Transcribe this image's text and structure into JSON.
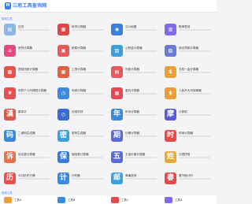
{
  "header": {
    "logo_glyph": "M",
    "site_name": "三思工具查询网"
  },
  "sections": {
    "first": "常用工具",
    "second": "查询工具"
  },
  "tools": [
    {
      "label": "日历",
      "icon": "calendar-icon",
      "glyph": "▤",
      "color": "#8bb8e8"
    },
    {
      "label": "科学计算器",
      "icon": "calculator-icon",
      "glyph": "▦",
      "color": "#e04848"
    },
    {
      "label": "汉斗地图",
      "icon": "map-icon",
      "glyph": "◉",
      "color": "#3a7fe0"
    },
    {
      "label": "账单签到",
      "icon": "bill-icon",
      "glyph": "▥",
      "color": "#7f6ae8"
    },
    {
      "label": "房贷计算器",
      "icon": "house-loan-icon",
      "glyph": "⌂",
      "color": "#e84a7f"
    },
    {
      "label": "税费计算器",
      "icon": "tax-icon",
      "glyph": "▣",
      "color": "#e85a5a"
    },
    {
      "label": "公积金计算器",
      "icon": "fund-icon",
      "glyph": "▧",
      "color": "#3aa0e0"
    },
    {
      "label": "综合贷款计算器",
      "icon": "loan-icon",
      "glyph": "▨",
      "color": "#6a7ad8"
    },
    {
      "label": "提前还款计算器",
      "icon": "repay-icon",
      "glyph": "▩",
      "color": "#e8504a"
    },
    {
      "label": "工资计算器",
      "icon": "salary-icon",
      "glyph": "▦",
      "color": "#e06040"
    },
    {
      "label": "利息计算器",
      "icon": "interest-icon",
      "glyph": "▤",
      "color": "#e8585f"
    },
    {
      "label": "五险一金计算器",
      "icon": "insurance-icon",
      "glyph": "$",
      "color": "#e8a03a"
    },
    {
      "label": "年终个人所得税计算器",
      "icon": "tax-person-icon",
      "glyph": "¥",
      "color": "#e85050"
    },
    {
      "label": "年龄计算器",
      "icon": "age-icon",
      "glyph": "◷",
      "color": "#3a8ae0"
    },
    {
      "label": "复利计算器",
      "icon": "compound-icon",
      "glyph": "▦",
      "color": "#e8484f"
    },
    {
      "label": "人民币大写转换器",
      "icon": "rmb-icon",
      "glyph": "$",
      "color": "#e8a03a"
    },
    {
      "label": "繁体字",
      "icon": "traditional-icon",
      "glyph": "漢",
      "color": "#e05848"
    },
    {
      "label": "在线时钟",
      "icon": "clock-icon",
      "glyph": "◴",
      "color": "#3a6ad8"
    },
    {
      "label": "年份计算器",
      "icon": "year-icon",
      "glyph": "年",
      "color": "#3a8ae0"
    },
    {
      "label": "计算机",
      "icon": "computer-icon",
      "glyph": "摩",
      "color": "#5a5ad8"
    },
    {
      "label": "二维码生成器",
      "icon": "qrcode-icon",
      "glyph": "码",
      "color": "#3a8ae0"
    },
    {
      "label": "密码生成器",
      "icon": "password-icon",
      "glyph": "密",
      "color": "#3aa0e0"
    },
    {
      "label": "日期计算器",
      "icon": "date-icon",
      "glyph": "期",
      "color": "#5a6ad8"
    },
    {
      "label": "时间计算器",
      "icon": "time-icon",
      "glyph": "时",
      "color": "#e84a4a"
    },
    {
      "label": "诉讼费计算器",
      "icon": "lawsuit-icon",
      "glyph": "诉",
      "color": "#e8704a"
    },
    {
      "label": "保险费计算器",
      "icon": "premium-icon",
      "glyph": "保",
      "color": "#3a7ad8"
    },
    {
      "label": "五金价格计算器",
      "icon": "hardware-icon",
      "glyph": "五",
      "color": "#5a6ad8"
    },
    {
      "label": "汉语拼音",
      "icon": "pinyin-icon",
      "glyph": "姓",
      "color": "#e8a83a"
    },
    {
      "label": "今日历史行情",
      "icon": "history-icon",
      "glyph": "历",
      "color": "#e8504a"
    },
    {
      "label": "计时器",
      "icon": "timer-icon",
      "glyph": "计",
      "color": "#3a8ae0"
    },
    {
      "label": "邮编查询",
      "icon": "postcode-icon",
      "glyph": "邮",
      "color": "#3aa0e0"
    },
    {
      "label": "春节倒计时",
      "icon": "spring-icon",
      "glyph": "春",
      "color": "#e84848"
    }
  ],
  "bottom_tools": [
    {
      "label": "工具A",
      "color": "#e8a03a"
    },
    {
      "label": "工具B",
      "color": "#3a8ae0"
    },
    {
      "label": "工具C",
      "color": "#e84a4a"
    },
    {
      "label": "工具D",
      "color": "#7f6ae8"
    }
  ]
}
